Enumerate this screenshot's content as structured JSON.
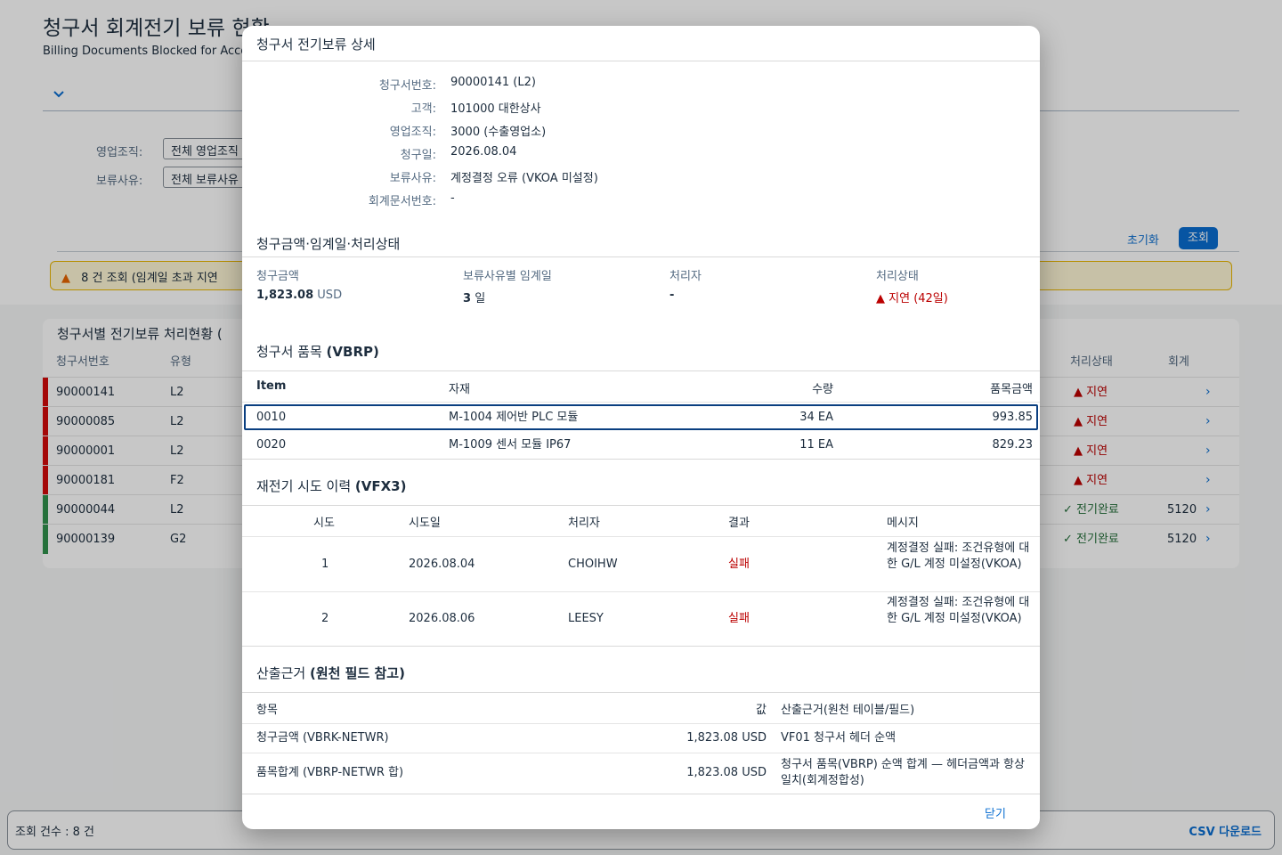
{
  "page": {
    "title": "청구서 회계전기 보류 현황",
    "subtitle": "Billing Documents Blocked for Accou"
  },
  "filters": [
    {
      "label": "영업조직:",
      "value": "전체 영업조직"
    },
    {
      "label": "보류사유:",
      "value": "전체 보류사유"
    }
  ],
  "actions": {
    "reset": "초기화",
    "go": "조회"
  },
  "warning": {
    "text": "8 건 조회 (임계일 초과 지연"
  },
  "table": {
    "title": "청구서별 전기보류 처리현황 (",
    "headers": {
      "doc": "청구서번호",
      "type": "유형",
      "status": "처리상태",
      "acct": "회계"
    },
    "rows": [
      {
        "doc": "90000141",
        "type": "L2",
        "status": "지연",
        "acct": "",
        "color": "#bb0000"
      },
      {
        "doc": "90000085",
        "type": "L2",
        "status": "지연",
        "acct": "",
        "color": "#bb0000"
      },
      {
        "doc": "90000001",
        "type": "L2",
        "status": "지연",
        "acct": "",
        "color": "#bb0000"
      },
      {
        "doc": "90000181",
        "type": "F2",
        "status": "지연",
        "acct": "",
        "color": "#bb0000"
      },
      {
        "doc": "90000044",
        "type": "L2",
        "status": "전기완료",
        "acct": "5120",
        "color": "#256f3a"
      },
      {
        "doc": "90000139",
        "type": "G2",
        "status": "전기완료",
        "acct": "5120",
        "color": "#256f3a"
      }
    ]
  },
  "footer": {
    "count": "조회 건수 : 8 건",
    "csv": "CSV 다운로드"
  },
  "dialog": {
    "title": "청구서 전기보류 상세",
    "fields": [
      {
        "label": "청구서번호:",
        "value": "90000141 (L2)"
      },
      {
        "label": "고객:",
        "value": "101000 대한상사"
      },
      {
        "label": "영업조직:",
        "value": "3000 (수출영업소)"
      },
      {
        "label": "청구일:",
        "value": "2026.08.04"
      },
      {
        "label": "보류사유:",
        "value": "계정결정 오류 (VKOA 미설정)"
      },
      {
        "label": "회계문서번호:",
        "value": "-"
      }
    ],
    "metrics_title": "청구금액·임계일·처리상태",
    "metrics": {
      "amount_label": "청구금액",
      "amount": "1,823.08",
      "currency": "USD",
      "threshold_label": "보류사유별 임계일",
      "threshold": "3",
      "threshold_unit": "일",
      "handler_label": "처리자",
      "handler": "-",
      "status_label": "처리상태",
      "status": "지연 (42일)"
    },
    "items": {
      "title_pre": "청구서 품목 ",
      "title_bold": "(VBRP)",
      "headers": {
        "item": "Item",
        "material": "자재",
        "qty": "수량",
        "amount": "품목금액"
      },
      "rows": [
        {
          "item": "0010",
          "material": "M-1004 제어반 PLC 모듈",
          "qty": "34 EA",
          "amount": "993.85"
        },
        {
          "item": "0020",
          "material": "M-1009 센서 모듈 IP67",
          "qty": "11 EA",
          "amount": "829.23"
        }
      ]
    },
    "retries": {
      "title_pre": "재전기 시도 이력 ",
      "title_bold": "(VFX3)",
      "headers": {
        "try": "시도",
        "date": "시도일",
        "user": "처리자",
        "result": "결과",
        "message": "메시지"
      },
      "rows": [
        {
          "try": "1",
          "date": "2026.08.04",
          "user": "CHOIHW",
          "result": "실패",
          "message": "계정결정 실패: 조건유형에 대한 G/L 계정 미설정(VKOA)"
        },
        {
          "try": "2",
          "date": "2026.08.06",
          "user": "LEESY",
          "result": "실패",
          "message": "계정결정 실패: 조건유형에 대한 G/L 계정 미설정(VKOA)"
        }
      ]
    },
    "basis": {
      "title_pre": "산출근거 ",
      "title_bold": "(원천 필드 참고)",
      "headers": {
        "item": "항목",
        "value": "값",
        "source": "산출근거(원천 테이블/필드)"
      },
      "rows": [
        {
          "item": "청구금액 (VBRK-NETWR)",
          "value": "1,823.08 USD",
          "source": "VF01 청구서 헤더 순액"
        },
        {
          "item": "품목합계 (VBRP-NETWR 합)",
          "value": "1,823.08 USD",
          "source": "청구서 품목(VBRP) 순액 합계 — 헤더금액과 항상 일치(회계정합성)"
        }
      ]
    },
    "close": "닫기"
  }
}
